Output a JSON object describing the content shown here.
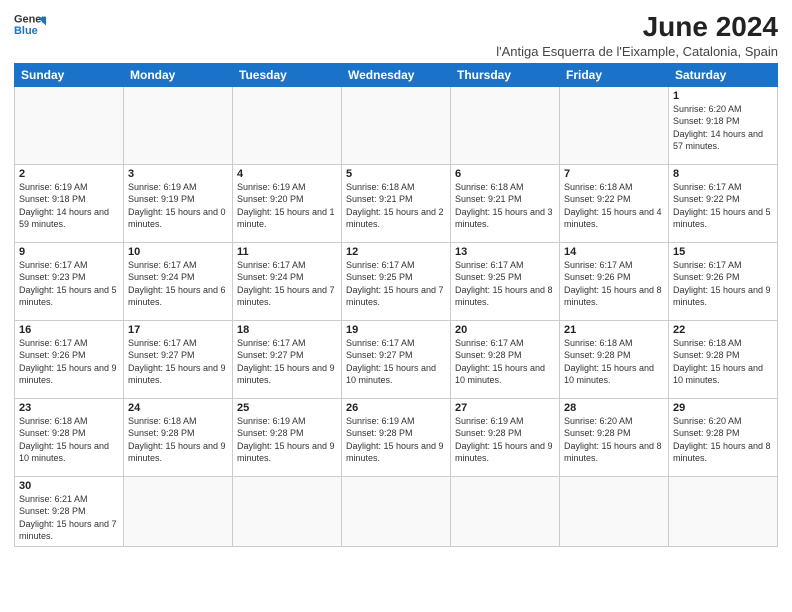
{
  "header": {
    "logo_general": "General",
    "logo_blue": "Blue",
    "month_year": "June 2024",
    "subtitle": "l'Antiga Esquerra de l'Eixample, Catalonia, Spain"
  },
  "weekdays": [
    "Sunday",
    "Monday",
    "Tuesday",
    "Wednesday",
    "Thursday",
    "Friday",
    "Saturday"
  ],
  "days": [
    {
      "date": 1,
      "sunrise": "6:20 AM",
      "sunset": "9:18 PM",
      "daylight": "14 hours and 57 minutes."
    },
    {
      "date": 2,
      "sunrise": "6:19 AM",
      "sunset": "9:18 PM",
      "daylight": "14 hours and 59 minutes."
    },
    {
      "date": 3,
      "sunrise": "6:19 AM",
      "sunset": "9:19 PM",
      "daylight": "15 hours and 0 minutes."
    },
    {
      "date": 4,
      "sunrise": "6:19 AM",
      "sunset": "9:20 PM",
      "daylight": "15 hours and 1 minute."
    },
    {
      "date": 5,
      "sunrise": "6:18 AM",
      "sunset": "9:21 PM",
      "daylight": "15 hours and 2 minutes."
    },
    {
      "date": 6,
      "sunrise": "6:18 AM",
      "sunset": "9:21 PM",
      "daylight": "15 hours and 3 minutes."
    },
    {
      "date": 7,
      "sunrise": "6:18 AM",
      "sunset": "9:22 PM",
      "daylight": "15 hours and 4 minutes."
    },
    {
      "date": 8,
      "sunrise": "6:17 AM",
      "sunset": "9:22 PM",
      "daylight": "15 hours and 5 minutes."
    },
    {
      "date": 9,
      "sunrise": "6:17 AM",
      "sunset": "9:23 PM",
      "daylight": "15 hours and 5 minutes."
    },
    {
      "date": 10,
      "sunrise": "6:17 AM",
      "sunset": "9:24 PM",
      "daylight": "15 hours and 6 minutes."
    },
    {
      "date": 11,
      "sunrise": "6:17 AM",
      "sunset": "9:24 PM",
      "daylight": "15 hours and 7 minutes."
    },
    {
      "date": 12,
      "sunrise": "6:17 AM",
      "sunset": "9:25 PM",
      "daylight": "15 hours and 7 minutes."
    },
    {
      "date": 13,
      "sunrise": "6:17 AM",
      "sunset": "9:25 PM",
      "daylight": "15 hours and 8 minutes."
    },
    {
      "date": 14,
      "sunrise": "6:17 AM",
      "sunset": "9:26 PM",
      "daylight": "15 hours and 8 minutes."
    },
    {
      "date": 15,
      "sunrise": "6:17 AM",
      "sunset": "9:26 PM",
      "daylight": "15 hours and 9 minutes."
    },
    {
      "date": 16,
      "sunrise": "6:17 AM",
      "sunset": "9:26 PM",
      "daylight": "15 hours and 9 minutes."
    },
    {
      "date": 17,
      "sunrise": "6:17 AM",
      "sunset": "9:27 PM",
      "daylight": "15 hours and 9 minutes."
    },
    {
      "date": 18,
      "sunrise": "6:17 AM",
      "sunset": "9:27 PM",
      "daylight": "15 hours and 9 minutes."
    },
    {
      "date": 19,
      "sunrise": "6:17 AM",
      "sunset": "9:27 PM",
      "daylight": "15 hours and 10 minutes."
    },
    {
      "date": 20,
      "sunrise": "6:17 AM",
      "sunset": "9:28 PM",
      "daylight": "15 hours and 10 minutes."
    },
    {
      "date": 21,
      "sunrise": "6:18 AM",
      "sunset": "9:28 PM",
      "daylight": "15 hours and 10 minutes."
    },
    {
      "date": 22,
      "sunrise": "6:18 AM",
      "sunset": "9:28 PM",
      "daylight": "15 hours and 10 minutes."
    },
    {
      "date": 23,
      "sunrise": "6:18 AM",
      "sunset": "9:28 PM",
      "daylight": "15 hours and 10 minutes."
    },
    {
      "date": 24,
      "sunrise": "6:18 AM",
      "sunset": "9:28 PM",
      "daylight": "15 hours and 9 minutes."
    },
    {
      "date": 25,
      "sunrise": "6:19 AM",
      "sunset": "9:28 PM",
      "daylight": "15 hours and 9 minutes."
    },
    {
      "date": 26,
      "sunrise": "6:19 AM",
      "sunset": "9:28 PM",
      "daylight": "15 hours and 9 minutes."
    },
    {
      "date": 27,
      "sunrise": "6:19 AM",
      "sunset": "9:28 PM",
      "daylight": "15 hours and 9 minutes."
    },
    {
      "date": 28,
      "sunrise": "6:20 AM",
      "sunset": "9:28 PM",
      "daylight": "15 hours and 8 minutes."
    },
    {
      "date": 29,
      "sunrise": "6:20 AM",
      "sunset": "9:28 PM",
      "daylight": "15 hours and 8 minutes."
    },
    {
      "date": 30,
      "sunrise": "6:21 AM",
      "sunset": "9:28 PM",
      "daylight": "15 hours and 7 minutes."
    }
  ]
}
